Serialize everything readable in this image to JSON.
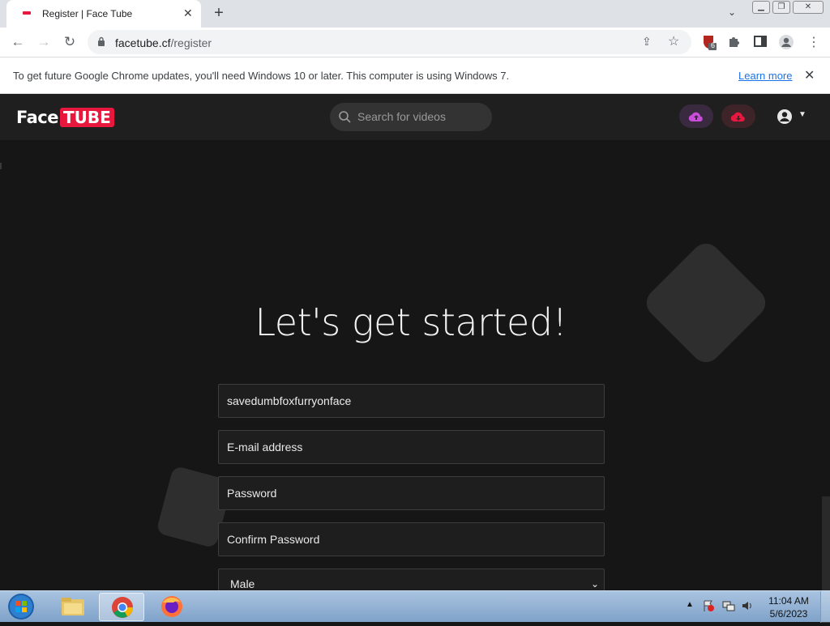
{
  "browser": {
    "tab_title": "Register | Face Tube",
    "url_host": "facetube.cf",
    "url_path": "/register",
    "extension_badge": "6",
    "colors": {
      "tabstrip": "#dee1e6",
      "accent": "#1a73e8"
    }
  },
  "infobar": {
    "message": "To get future Google Chrome updates, you'll need Windows 10 or later. This computer is using Windows 7.",
    "link": "Learn more"
  },
  "site": {
    "logo_face": "Face",
    "logo_tube": "TUBE",
    "search_placeholder": "Search for videos",
    "brand_red": "#e8173e",
    "upload_color": "#c94dd9",
    "download_color": "#e8173e"
  },
  "form": {
    "headline": "Let's get started!",
    "username_value": "savedumbfoxfurryonface",
    "email_placeholder": "E-mail address",
    "password_placeholder": "Password",
    "confirm_placeholder": "Confirm Password",
    "gender_selected": "Male"
  },
  "taskbar": {
    "time": "11:04 AM",
    "date": "5/6/2023"
  }
}
